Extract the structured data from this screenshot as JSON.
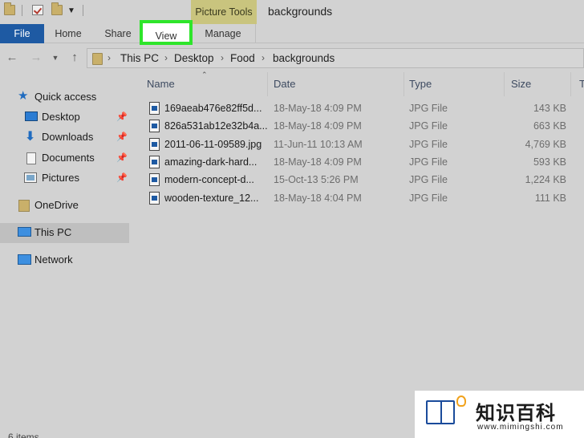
{
  "titlebar": {
    "contextual_tab": "Picture Tools",
    "window_title": "backgrounds"
  },
  "ribbon": {
    "tabs": [
      {
        "label": "File"
      },
      {
        "label": "Home"
      },
      {
        "label": "Share"
      },
      {
        "label": "View"
      },
      {
        "label": "Manage"
      }
    ],
    "highlighted_tab": "View",
    "highlight_color": "#2ee52a",
    "file_tab_color": "#1e5aa3"
  },
  "nav": {
    "back_icon": "arrow-left",
    "forward_icon": "arrow-right",
    "recent_icon": "chevron-down",
    "up_icon": "arrow-up",
    "breadcrumb": [
      "This PC",
      "Desktop",
      "Food",
      "backgrounds"
    ],
    "separator": "›"
  },
  "sidebar": {
    "items": [
      {
        "label": "Quick access",
        "icon": "star-icon",
        "pinned": false
      },
      {
        "label": "Desktop",
        "icon": "desktop-icon",
        "pinned": true
      },
      {
        "label": "Downloads",
        "icon": "download-icon",
        "pinned": true
      },
      {
        "label": "Documents",
        "icon": "documents-icon",
        "pinned": true
      },
      {
        "label": "Pictures",
        "icon": "pictures-icon",
        "pinned": true
      },
      {
        "label": "OneDrive",
        "icon": "folder-icon",
        "pinned": false
      },
      {
        "label": "This PC",
        "icon": "computer-icon",
        "pinned": false,
        "selected": true
      },
      {
        "label": "Network",
        "icon": "network-icon",
        "pinned": false
      }
    ]
  },
  "files": {
    "columns": [
      "Name",
      "Date",
      "Type",
      "Size",
      "T"
    ],
    "rows": [
      {
        "name": "169aeab476e82ff5d...",
        "date": "18-May-18 4:09 PM",
        "type": "JPG File",
        "size": "143 KB"
      },
      {
        "name": "826a531ab12e32b4a...",
        "date": "18-May-18 4:09 PM",
        "type": "JPG File",
        "size": "663 KB"
      },
      {
        "name": "2011-06-11-09589.jpg",
        "date": "11-Jun-11 10:13 AM",
        "type": "JPG File",
        "size": "4,769 KB"
      },
      {
        "name": "amazing-dark-hard...",
        "date": "18-May-18 4:09 PM",
        "type": "JPG File",
        "size": "593 KB"
      },
      {
        "name": "modern-concept-d...",
        "date": "15-Oct-13 5:26 PM",
        "type": "JPG File",
        "size": "1,224 KB"
      },
      {
        "name": "wooden-texture_12...",
        "date": "18-May-18 4:04 PM",
        "type": "JPG File",
        "size": "111 KB"
      }
    ]
  },
  "status": {
    "item_count": "6 items"
  },
  "watermark": {
    "brand_cn": "知识百科",
    "url": "www.mimingshi.com"
  }
}
